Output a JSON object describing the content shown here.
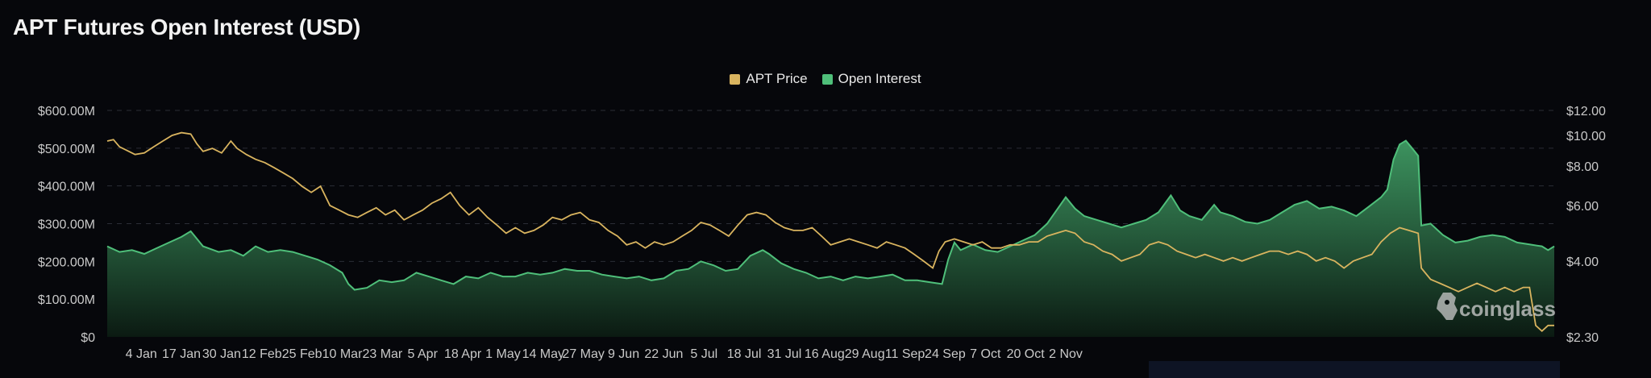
{
  "title": "APT Futures Open Interest (USD)",
  "legend": {
    "price_label": "APT Price",
    "oi_label": "Open Interest"
  },
  "colors": {
    "background": "#06070b",
    "price": "#d9b45f",
    "oi_line": "#4fbf7a",
    "oi_fill_top": "#3f9a63",
    "oi_fill_bottom": "#0b1a12",
    "grid": "#2a2d36",
    "axis_text": "#c9c9c9"
  },
  "watermark": "coinglass",
  "chart_data": {
    "type": "area",
    "title": "APT Futures Open Interest (USD)",
    "categories": [
      "4 Jan",
      "17 Jan",
      "30 Jan",
      "12 Feb",
      "25 Feb",
      "10 Mar",
      "23 Mar",
      "5 Apr",
      "18 Apr",
      "1 May",
      "14 May",
      "27 May",
      "9 Jun",
      "22 Jun",
      "5 Jul",
      "18 Jul",
      "31 Jul",
      "16 Aug",
      "29 Aug",
      "11 Sep",
      "24 Sep",
      "7 Oct",
      "20 Oct",
      "2 Nov"
    ],
    "x_range": [
      "24 Dec",
      "5 Nov"
    ],
    "y_left": {
      "label": "Open Interest",
      "ticks": [
        "$0",
        "$100.00M",
        "$200.00M",
        "$300.00M",
        "$400.00M",
        "$500.00M",
        "$600.00M"
      ],
      "range": [
        0,
        600
      ]
    },
    "y_right": {
      "label": "APT Price",
      "ticks": [
        "$2.30",
        "$4.00",
        "$6.00",
        "$8.00",
        "$10.00",
        "$12.00"
      ],
      "range": [
        2.3,
        12
      ],
      "scale": "log"
    },
    "grid": true,
    "legend_position": "top-center",
    "series": [
      {
        "name": "Open Interest",
        "axis": "left",
        "unit": "USD millions",
        "points": [
          [
            0,
            240
          ],
          [
            4,
            225
          ],
          [
            8,
            230
          ],
          [
            12,
            220
          ],
          [
            16,
            235
          ],
          [
            20,
            250
          ],
          [
            24,
            265
          ],
          [
            27,
            280
          ],
          [
            31,
            240
          ],
          [
            36,
            225
          ],
          [
            40,
            230
          ],
          [
            44,
            215
          ],
          [
            48,
            240
          ],
          [
            52,
            225
          ],
          [
            56,
            230
          ],
          [
            60,
            225
          ],
          [
            64,
            215
          ],
          [
            68,
            205
          ],
          [
            72,
            190
          ],
          [
            76,
            170
          ],
          [
            78,
            140
          ],
          [
            80,
            125
          ],
          [
            84,
            130
          ],
          [
            88,
            150
          ],
          [
            92,
            145
          ],
          [
            96,
            150
          ],
          [
            100,
            170
          ],
          [
            104,
            160
          ],
          [
            108,
            150
          ],
          [
            112,
            140
          ],
          [
            116,
            160
          ],
          [
            120,
            155
          ],
          [
            124,
            170
          ],
          [
            128,
            160
          ],
          [
            132,
            160
          ],
          [
            136,
            170
          ],
          [
            140,
            165
          ],
          [
            144,
            170
          ],
          [
            148,
            180
          ],
          [
            152,
            175
          ],
          [
            156,
            175
          ],
          [
            160,
            165
          ],
          [
            164,
            160
          ],
          [
            168,
            155
          ],
          [
            172,
            160
          ],
          [
            176,
            150
          ],
          [
            180,
            155
          ],
          [
            184,
            175
          ],
          [
            188,
            180
          ],
          [
            192,
            200
          ],
          [
            196,
            190
          ],
          [
            200,
            175
          ],
          [
            204,
            180
          ],
          [
            208,
            215
          ],
          [
            212,
            230
          ],
          [
            214,
            220
          ],
          [
            218,
            195
          ],
          [
            222,
            180
          ],
          [
            226,
            170
          ],
          [
            230,
            155
          ],
          [
            234,
            160
          ],
          [
            238,
            150
          ],
          [
            242,
            160
          ],
          [
            246,
            155
          ],
          [
            250,
            160
          ],
          [
            254,
            165
          ],
          [
            258,
            150
          ],
          [
            262,
            150
          ],
          [
            266,
            145
          ],
          [
            270,
            140
          ],
          [
            272,
            205
          ],
          [
            274,
            250
          ],
          [
            276,
            230
          ],
          [
            280,
            245
          ],
          [
            284,
            230
          ],
          [
            288,
            225
          ],
          [
            292,
            240
          ],
          [
            296,
            255
          ],
          [
            300,
            270
          ],
          [
            304,
            300
          ],
          [
            307,
            335
          ],
          [
            310,
            370
          ],
          [
            313,
            340
          ],
          [
            316,
            320
          ],
          [
            320,
            310
          ],
          [
            324,
            300
          ],
          [
            328,
            290
          ],
          [
            332,
            300
          ],
          [
            336,
            310
          ],
          [
            340,
            330
          ],
          [
            344,
            375
          ],
          [
            347,
            335
          ],
          [
            350,
            320
          ],
          [
            354,
            310
          ],
          [
            358,
            350
          ],
          [
            360,
            330
          ],
          [
            364,
            320
          ],
          [
            368,
            305
          ],
          [
            372,
            300
          ],
          [
            376,
            310
          ],
          [
            380,
            330
          ],
          [
            384,
            350
          ],
          [
            388,
            360
          ],
          [
            392,
            340
          ],
          [
            396,
            345
          ],
          [
            400,
            335
          ],
          [
            404,
            320
          ],
          [
            408,
            345
          ],
          [
            412,
            370
          ],
          [
            414,
            390
          ],
          [
            416,
            470
          ],
          [
            418,
            510
          ],
          [
            420,
            520
          ],
          [
            422,
            500
          ],
          [
            424,
            480
          ],
          [
            425,
            295
          ],
          [
            428,
            300
          ],
          [
            432,
            270
          ],
          [
            436,
            250
          ],
          [
            440,
            255
          ],
          [
            444,
            265
          ],
          [
            448,
            270
          ],
          [
            452,
            265
          ],
          [
            456,
            250
          ],
          [
            460,
            245
          ],
          [
            464,
            240
          ],
          [
            466,
            230
          ],
          [
            468,
            240
          ]
        ]
      },
      {
        "name": "APT Price",
        "axis": "right",
        "unit": "USD",
        "points": [
          [
            0,
            9.6
          ],
          [
            2,
            9.7
          ],
          [
            4,
            9.2
          ],
          [
            6,
            9.0
          ],
          [
            9,
            8.7
          ],
          [
            12,
            8.8
          ],
          [
            15,
            9.2
          ],
          [
            18,
            9.6
          ],
          [
            21,
            10.0
          ],
          [
            24,
            10.2
          ],
          [
            27,
            10.1
          ],
          [
            29,
            9.4
          ],
          [
            31,
            8.9
          ],
          [
            34,
            9.1
          ],
          [
            37,
            8.8
          ],
          [
            40,
            9.6
          ],
          [
            42,
            9.1
          ],
          [
            45,
            8.7
          ],
          [
            48,
            8.4
          ],
          [
            51,
            8.2
          ],
          [
            54,
            7.9
          ],
          [
            57,
            7.6
          ],
          [
            60,
            7.3
          ],
          [
            63,
            6.9
          ],
          [
            66,
            6.6
          ],
          [
            69,
            6.9
          ],
          [
            72,
            6.0
          ],
          [
            75,
            5.8
          ],
          [
            78,
            5.6
          ],
          [
            81,
            5.5
          ],
          [
            84,
            5.7
          ],
          [
            87,
            5.9
          ],
          [
            90,
            5.6
          ],
          [
            93,
            5.8
          ],
          [
            96,
            5.4
          ],
          [
            99,
            5.6
          ],
          [
            102,
            5.8
          ],
          [
            105,
            6.1
          ],
          [
            108,
            6.3
          ],
          [
            111,
            6.6
          ],
          [
            114,
            6.0
          ],
          [
            117,
            5.6
          ],
          [
            120,
            5.9
          ],
          [
            123,
            5.5
          ],
          [
            126,
            5.2
          ],
          [
            129,
            4.9
          ],
          [
            132,
            5.1
          ],
          [
            135,
            4.9
          ],
          [
            138,
            5.0
          ],
          [
            141,
            5.2
          ],
          [
            144,
            5.5
          ],
          [
            147,
            5.4
          ],
          [
            150,
            5.6
          ],
          [
            153,
            5.7
          ],
          [
            156,
            5.4
          ],
          [
            159,
            5.3
          ],
          [
            162,
            5.0
          ],
          [
            165,
            4.8
          ],
          [
            168,
            4.5
          ],
          [
            171,
            4.6
          ],
          [
            174,
            4.4
          ],
          [
            177,
            4.6
          ],
          [
            180,
            4.5
          ],
          [
            183,
            4.6
          ],
          [
            186,
            4.8
          ],
          [
            189,
            5.0
          ],
          [
            192,
            5.3
          ],
          [
            195,
            5.2
          ],
          [
            198,
            5.0
          ],
          [
            201,
            4.8
          ],
          [
            204,
            5.2
          ],
          [
            207,
            5.6
          ],
          [
            210,
            5.7
          ],
          [
            213,
            5.6
          ],
          [
            216,
            5.3
          ],
          [
            219,
            5.1
          ],
          [
            222,
            5.0
          ],
          [
            225,
            5.0
          ],
          [
            228,
            5.1
          ],
          [
            231,
            4.8
          ],
          [
            234,
            4.5
          ],
          [
            237,
            4.6
          ],
          [
            240,
            4.7
          ],
          [
            243,
            4.6
          ],
          [
            246,
            4.5
          ],
          [
            249,
            4.4
          ],
          [
            252,
            4.6
          ],
          [
            255,
            4.5
          ],
          [
            258,
            4.4
          ],
          [
            261,
            4.2
          ],
          [
            264,
            4.0
          ],
          [
            267,
            3.8
          ],
          [
            269,
            4.3
          ],
          [
            271,
            4.6
          ],
          [
            274,
            4.7
          ],
          [
            277,
            4.6
          ],
          [
            280,
            4.5
          ],
          [
            283,
            4.6
          ],
          [
            286,
            4.4
          ],
          [
            289,
            4.4
          ],
          [
            292,
            4.5
          ],
          [
            295,
            4.5
          ],
          [
            298,
            4.6
          ],
          [
            301,
            4.6
          ],
          [
            304,
            4.8
          ],
          [
            307,
            4.9
          ],
          [
            310,
            5.0
          ],
          [
            313,
            4.9
          ],
          [
            316,
            4.6
          ],
          [
            319,
            4.5
          ],
          [
            322,
            4.3
          ],
          [
            325,
            4.2
          ],
          [
            328,
            4.0
          ],
          [
            331,
            4.1
          ],
          [
            334,
            4.2
          ],
          [
            337,
            4.5
          ],
          [
            340,
            4.6
          ],
          [
            343,
            4.5
          ],
          [
            346,
            4.3
          ],
          [
            349,
            4.2
          ],
          [
            352,
            4.1
          ],
          [
            355,
            4.2
          ],
          [
            358,
            4.1
          ],
          [
            361,
            4.0
          ],
          [
            364,
            4.1
          ],
          [
            367,
            4.0
          ],
          [
            370,
            4.1
          ],
          [
            373,
            4.2
          ],
          [
            376,
            4.3
          ],
          [
            379,
            4.3
          ],
          [
            382,
            4.2
          ],
          [
            385,
            4.3
          ],
          [
            388,
            4.2
          ],
          [
            391,
            4.0
          ],
          [
            394,
            4.1
          ],
          [
            397,
            4.0
          ],
          [
            400,
            3.8
          ],
          [
            403,
            4.0
          ],
          [
            406,
            4.1
          ],
          [
            409,
            4.2
          ],
          [
            412,
            4.6
          ],
          [
            415,
            4.9
          ],
          [
            418,
            5.1
          ],
          [
            421,
            5.0
          ],
          [
            424,
            4.9
          ],
          [
            425,
            3.8
          ],
          [
            428,
            3.5
          ],
          [
            431,
            3.4
          ],
          [
            434,
            3.3
          ],
          [
            437,
            3.2
          ],
          [
            440,
            3.3
          ],
          [
            443,
            3.4
          ],
          [
            446,
            3.3
          ],
          [
            449,
            3.2
          ],
          [
            452,
            3.3
          ],
          [
            455,
            3.2
          ],
          [
            458,
            3.3
          ],
          [
            460,
            3.3
          ],
          [
            462,
            2.5
          ],
          [
            464,
            2.4
          ],
          [
            466,
            2.5
          ],
          [
            468,
            2.5
          ]
        ]
      }
    ]
  }
}
